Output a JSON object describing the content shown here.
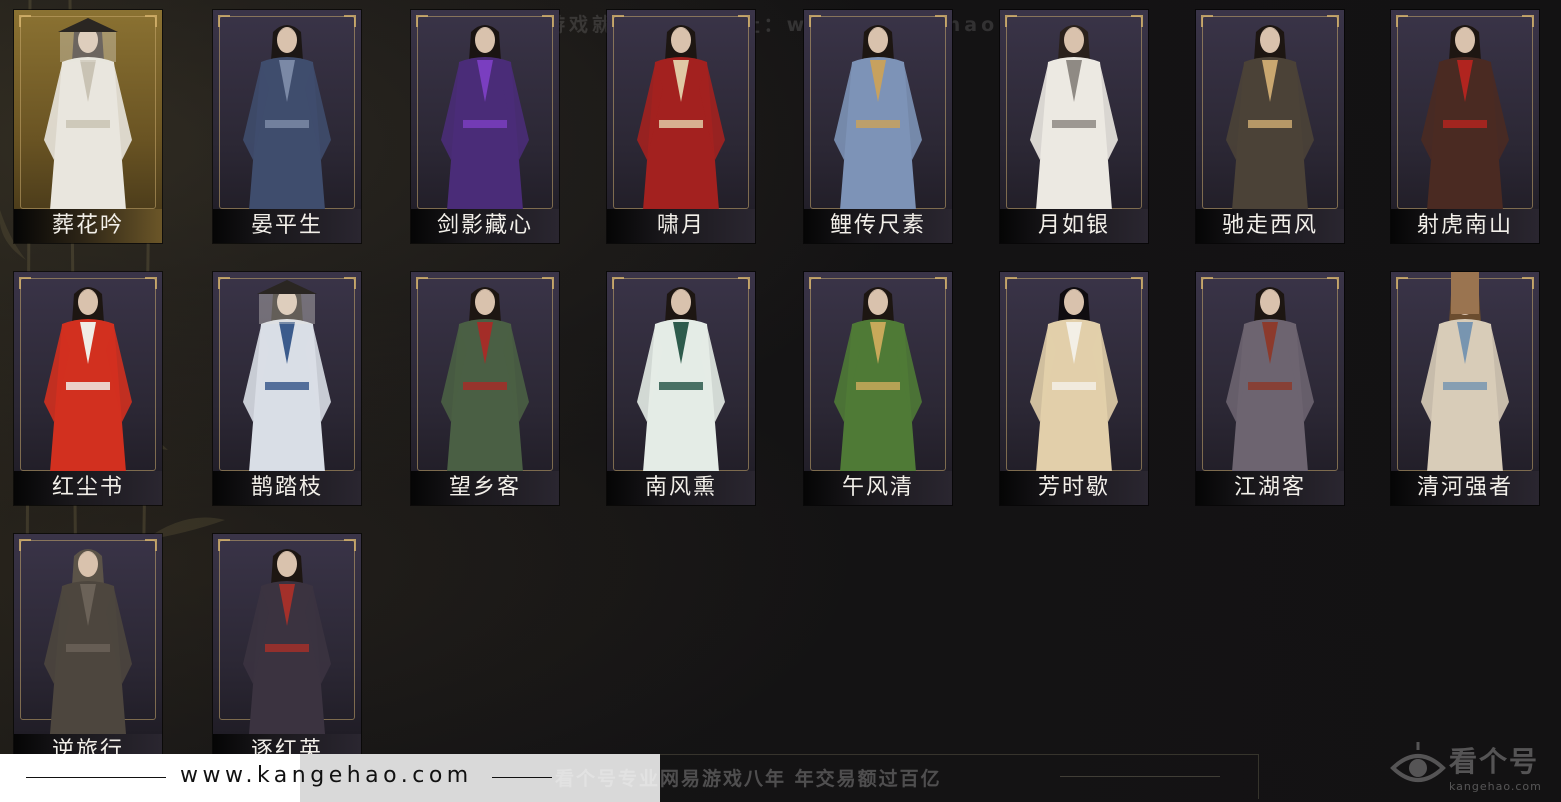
{
  "watermark_top": "网易游戏就选看个号   网址：www.kangehao.com",
  "costumes": [
    {
      "name": "葬花吟",
      "rarity": "gold",
      "hair": "#2a211c",
      "robe": "#e9e6de",
      "accent": "#c9c3b4",
      "hat": true
    },
    {
      "name": "晏平生",
      "rarity": "purple",
      "hair": "#1c1715",
      "robe": "#3f4d6d",
      "accent": "#7b89a6"
    },
    {
      "name": "剑影藏心",
      "rarity": "purple",
      "hair": "#1a1412",
      "robe": "#4a2c78",
      "accent": "#7a3ec0"
    },
    {
      "name": "啸月",
      "rarity": "purple",
      "hair": "#1d1612",
      "robe": "#a3211f",
      "accent": "#e0c9a4"
    },
    {
      "name": "鲤传尺素",
      "rarity": "purple",
      "hair": "#1d1612",
      "robe": "#7d93b7",
      "accent": "#c7a15e"
    },
    {
      "name": "月如银",
      "rarity": "purple",
      "hair": "#2a211c",
      "robe": "#ece9e2",
      "accent": "#8f8a84"
    },
    {
      "name": "驰走西风",
      "rarity": "purple",
      "hair": "#1d1612",
      "robe": "#4b4237",
      "accent": "#c9a770"
    },
    {
      "name": "射虎南山",
      "rarity": "purple",
      "hair": "#1d1612",
      "robe": "#4a2a22",
      "accent": "#b1241f"
    },
    {
      "name": "红尘书",
      "rarity": "purple",
      "hair": "#1d1612",
      "robe": "#d2301f",
      "accent": "#f0ece6"
    },
    {
      "name": "鹊踏枝",
      "rarity": "purple",
      "hair": "#1d1612",
      "robe": "#d9dee6",
      "accent": "#3b5b8c",
      "hat": true
    },
    {
      "name": "望乡客",
      "rarity": "purple",
      "hair": "#1d1612",
      "robe": "#4a5f44",
      "accent": "#a42d28"
    },
    {
      "name": "南风熏",
      "rarity": "purple",
      "hair": "#1d1612",
      "robe": "#e4ece6",
      "accent": "#2d5b4c"
    },
    {
      "name": "午风清",
      "rarity": "purple",
      "hair": "#1d1612",
      "robe": "#4f7a36",
      "accent": "#c8a95a"
    },
    {
      "name": "芳时歇",
      "rarity": "purple",
      "hair": "#0f0c10",
      "robe": "#e2cfaa",
      "accent": "#f3efe6"
    },
    {
      "name": "江湖客",
      "rarity": "purple",
      "hair": "#1d1612",
      "robe": "#6d6470",
      "accent": "#8c3a2c"
    },
    {
      "name": "清河强者",
      "rarity": "purple",
      "hair": "#6b4d2f",
      "robe": "#d8ccb8",
      "accent": "#7895b0",
      "bucket": true
    },
    {
      "name": "逆旅行",
      "rarity": "purple",
      "hair": "#5b5348",
      "robe": "#4d463e",
      "accent": "#6b6258",
      "partial": true
    },
    {
      "name": "逐红英",
      "rarity": "purple",
      "hair": "#1d1612",
      "robe": "#3b3340",
      "accent": "#a3302a",
      "partial": true
    }
  ],
  "bottom_bar": {
    "site_url": "www.kangehao.com",
    "slogan": "看个号专业网易游戏八年   年交易额过百亿"
  },
  "logo": {
    "text": "看个号",
    "sub": "kangehao.com"
  }
}
